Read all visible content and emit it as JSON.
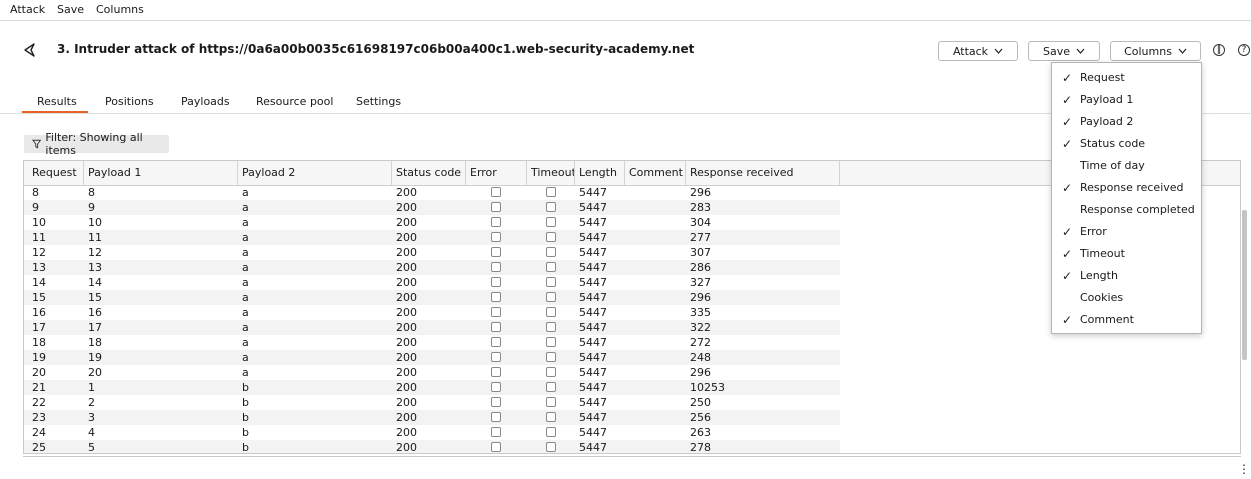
{
  "menubar": {
    "attack": "Attack",
    "save": "Save",
    "columns": "Columns"
  },
  "header": {
    "title": "3. Intruder attack of https://0a6a00b0035c61698197c06b00a400c1.web-security-academy.net",
    "attack_btn": "Attack",
    "save_btn": "Save",
    "columns_btn": "Columns",
    "pause_icon": "pause-icon",
    "help_icon": "help-icon"
  },
  "tabs": [
    "Results",
    "Positions",
    "Payloads",
    "Resource pool",
    "Settings"
  ],
  "filter": {
    "label": "Filter: Showing all items"
  },
  "table": {
    "headers": [
      "Request",
      "Payload 1",
      "Payload 2",
      "Status code",
      "Error",
      "Timeout",
      "Length",
      "Comment",
      "Response received"
    ],
    "rows": [
      [
        "8",
        "8",
        "a",
        "200",
        "5447",
        "296"
      ],
      [
        "9",
        "9",
        "a",
        "200",
        "5447",
        "283"
      ],
      [
        "10",
        "10",
        "a",
        "200",
        "5447",
        "304"
      ],
      [
        "11",
        "11",
        "a",
        "200",
        "5447",
        "277"
      ],
      [
        "12",
        "12",
        "a",
        "200",
        "5447",
        "307"
      ],
      [
        "13",
        "13",
        "a",
        "200",
        "5447",
        "286"
      ],
      [
        "14",
        "14",
        "a",
        "200",
        "5447",
        "327"
      ],
      [
        "15",
        "15",
        "a",
        "200",
        "5447",
        "296"
      ],
      [
        "16",
        "16",
        "a",
        "200",
        "5447",
        "335"
      ],
      [
        "17",
        "17",
        "a",
        "200",
        "5447",
        "322"
      ],
      [
        "18",
        "18",
        "a",
        "200",
        "5447",
        "272"
      ],
      [
        "19",
        "19",
        "a",
        "200",
        "5447",
        "248"
      ],
      [
        "20",
        "20",
        "a",
        "200",
        "5447",
        "296"
      ],
      [
        "21",
        "1",
        "b",
        "200",
        "5447",
        "10253"
      ],
      [
        "22",
        "2",
        "b",
        "200",
        "5447",
        "250"
      ],
      [
        "23",
        "3",
        "b",
        "200",
        "5447",
        "256"
      ],
      [
        "24",
        "4",
        "b",
        "200",
        "5447",
        "263"
      ],
      [
        "25",
        "5",
        "b",
        "200",
        "5447",
        "278"
      ]
    ]
  },
  "columns_menu": [
    {
      "label": "Request",
      "checked": true
    },
    {
      "label": "Payload 1",
      "checked": true
    },
    {
      "label": "Payload 2",
      "checked": true
    },
    {
      "label": "Status code",
      "checked": true
    },
    {
      "label": "Time of day",
      "checked": false
    },
    {
      "label": "Response received",
      "checked": true
    },
    {
      "label": "Response completed",
      "checked": false
    },
    {
      "label": "Error",
      "checked": true
    },
    {
      "label": "Timeout",
      "checked": true
    },
    {
      "label": "Length",
      "checked": true
    },
    {
      "label": "Cookies",
      "checked": false
    },
    {
      "label": "Comment",
      "checked": true
    }
  ],
  "colors": {
    "accent": "#e8622c",
    "row_alt": "#f3f3f3"
  }
}
